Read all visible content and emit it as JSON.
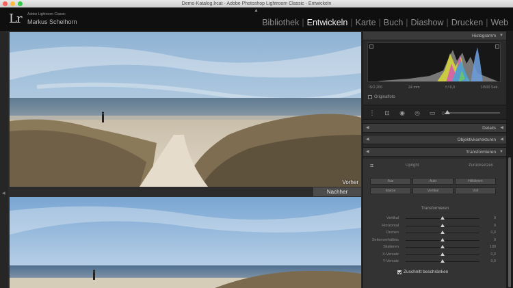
{
  "window": {
    "title": "Demo-Katalog.lrcat - Adobe Photoshop Lightroom Classic - Entwickeln"
  },
  "identity": {
    "logo": "Lr",
    "product": "Adobe Lightroom Classic",
    "user": "Markus Schelhorn"
  },
  "modules": [
    {
      "label": "Bibliothek",
      "active": false
    },
    {
      "label": "Entwickeln",
      "active": true
    },
    {
      "label": "Karte",
      "active": false
    },
    {
      "label": "Buch",
      "active": false
    },
    {
      "label": "Diashow",
      "active": false
    },
    {
      "label": "Drucken",
      "active": false
    },
    {
      "label": "Web",
      "active": false
    }
  ],
  "view": {
    "before_label": "Vorher",
    "after_label": "Nachher"
  },
  "histogram": {
    "title": "Histogramm",
    "iso": "ISO 200",
    "focal": "24 mm",
    "aperture": "f / 8,0",
    "shutter": "1/500 Sek.",
    "original_label": "Originalfoto"
  },
  "panels": {
    "details": "Details",
    "lens": "Objektivkorrekturen",
    "transform": "Transformieren"
  },
  "transform": {
    "upright": "Upright",
    "reset": "Zurücksetzen",
    "buttons_row1": [
      "Aus",
      "Auto",
      "Hilfslinien"
    ],
    "buttons_row2": [
      "Ebene",
      "Vertikal",
      "Voll"
    ],
    "subheading": "Transformieren",
    "sliders": [
      {
        "label": "Vertikal",
        "value": "0",
        "pos": 0.5
      },
      {
        "label": "Horizontal",
        "value": "0",
        "pos": 0.5
      },
      {
        "label": "Drehen",
        "value": "0,0",
        "pos": 0.5
      },
      {
        "label": "Seitenverhältnis",
        "value": "0",
        "pos": 0.5
      },
      {
        "label": "Skalieren",
        "value": "100",
        "pos": 0.5
      },
      {
        "label": "X-Versatz",
        "value": "0,0",
        "pos": 0.5
      },
      {
        "label": "Y-Versatz",
        "value": "0,0",
        "pos": 0.5
      }
    ],
    "constrain_crop": "Zuschnitt beschränken"
  },
  "colors": {
    "active_module": "#f2f2f2",
    "inactive_module": "#8d8d8d",
    "panel_bg": "#2a2a2a"
  }
}
